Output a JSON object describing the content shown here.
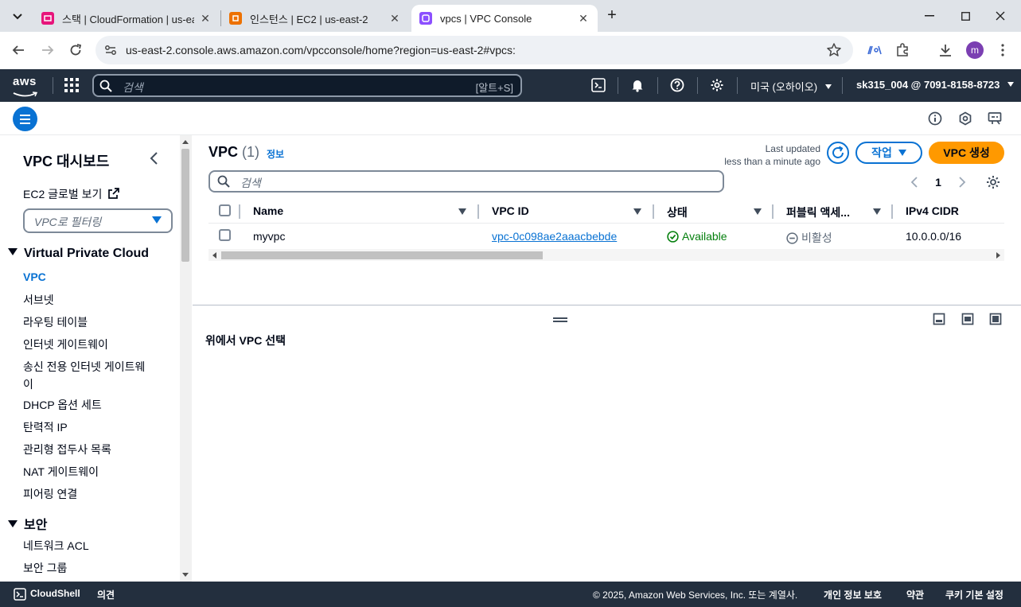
{
  "browser": {
    "tabs": [
      {
        "title": "스택 | CloudFormation | us-ea",
        "favicon_color": "#e7157b"
      },
      {
        "title": "인스턴스 | EC2 | us-east-2",
        "favicon_color": "#ed7100"
      },
      {
        "title": "vpcs | VPC Console",
        "favicon_color": "#8c4fff"
      }
    ],
    "new_tab": "+",
    "url": "us-east-2.console.aws.amazon.com/vpcconsole/home?region=us-east-2#vpcs:",
    "profile_initial": "m"
  },
  "aws_header": {
    "logo": "aws",
    "search_placeholder": "검색",
    "search_shortcut": "[알트+S]",
    "region": "미국 (오하이오)",
    "account": "sk315_004 @ 7091-8158-8723"
  },
  "sidebar": {
    "title": "VPC 대시보드",
    "ec2_global": "EC2 글로벌 보기",
    "filter_placeholder": "VPC로 필터링",
    "section_vpc": "Virtual Private Cloud",
    "items": [
      {
        "label": "VPC",
        "active": true
      },
      {
        "label": "서브넷"
      },
      {
        "label": "라우팅 테이블"
      },
      {
        "label": "인터넷 게이트웨이"
      },
      {
        "label": "송신 전용 인터넷 게이트웨",
        "label2": "이"
      },
      {
        "label": "DHCP 옵션 세트"
      },
      {
        "label": "탄력적 IP"
      },
      {
        "label": "관리형 접두사 목록"
      },
      {
        "label": "NAT 게이트웨이"
      },
      {
        "label": "피어링 연결"
      }
    ],
    "section_security": "보안",
    "security_items": [
      {
        "label": "네트워크 ACL"
      },
      {
        "label": "보안 그룹"
      }
    ]
  },
  "main": {
    "title": "VPC",
    "count": "(1)",
    "info": "정보",
    "last_updated_line1": "Last updated",
    "last_updated_line2": "less than a minute ago",
    "actions_label": "작업",
    "create_label": "VPC 생성",
    "search_placeholder": "검색",
    "page": "1",
    "columns": [
      "Name",
      "VPC ID",
      "상태",
      "퍼블릭 액세...",
      "IPv4 CIDR"
    ],
    "rows": [
      {
        "name": "myvpc",
        "vpc_id": "vpc-0c098ae2aaacbebde",
        "status": "Available",
        "public_access": "비활성",
        "cidr": "10.0.0.0/16"
      }
    ],
    "split_message": "위에서 VPC 선택"
  },
  "footer": {
    "cloudshell": "CloudShell",
    "feedback": "의견",
    "copyright": "© 2025, Amazon Web Services, Inc. 또는 계열사.",
    "privacy": "개인 정보 보호",
    "terms": "약관",
    "cookies": "쿠키 기본 설정"
  },
  "colors": {
    "aws_dark": "#232f3e",
    "primary_blue": "#0972d3",
    "orange": "#ff9900",
    "success_green": "#037f0c"
  }
}
